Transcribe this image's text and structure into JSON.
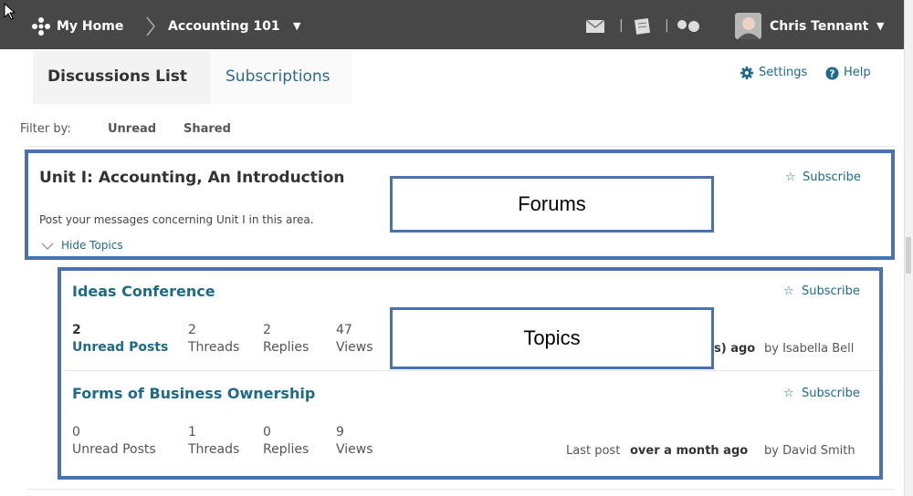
{
  "nav": {
    "home_label": "My Home",
    "course_label": "Accounting 101",
    "user_name": "Chris Tennant",
    "divider": "|"
  },
  "tabs": {
    "active": "Discussions List",
    "other": "Subscriptions"
  },
  "header_links": {
    "settings": "Settings",
    "help": "Help"
  },
  "filter": {
    "label": "Filter by:",
    "options": [
      "Unread",
      "Shared"
    ]
  },
  "forum": {
    "title": "Unit I: Accounting, An Introduction",
    "description": "Post your messages concerning Unit I in this area.",
    "subscribe": "Subscribe",
    "hide_topics": "Hide Topics"
  },
  "topics": [
    {
      "title": "Ideas Conference",
      "subscribe": "Subscribe",
      "unread_posts": "2",
      "unread_label": "Unread Posts",
      "threads": "2",
      "threads_label": "Threads",
      "replies": "2",
      "replies_label": "Replies",
      "views": "47",
      "views_label": "Views",
      "last_post_bold": "s) ago",
      "last_post_by": "by Isabella Bell"
    },
    {
      "title": "Forms of Business Ownership",
      "subscribe": "Subscribe",
      "unread_posts": "0",
      "unread_label": "Unread Posts",
      "threads": "1",
      "threads_label": "Threads",
      "replies": "0",
      "replies_label": "Replies",
      "views": "9",
      "views_label": "Views",
      "last_post_prefix": "Last post",
      "last_post_bold": "over a month ago",
      "last_post_by": "by David Smith"
    }
  ],
  "annotations": {
    "forums": "Forums",
    "topics": "Topics"
  },
  "colors": {
    "nav_bg": "#474747",
    "link": "#1d6a8a",
    "annotation_border": "#4a73ad"
  }
}
